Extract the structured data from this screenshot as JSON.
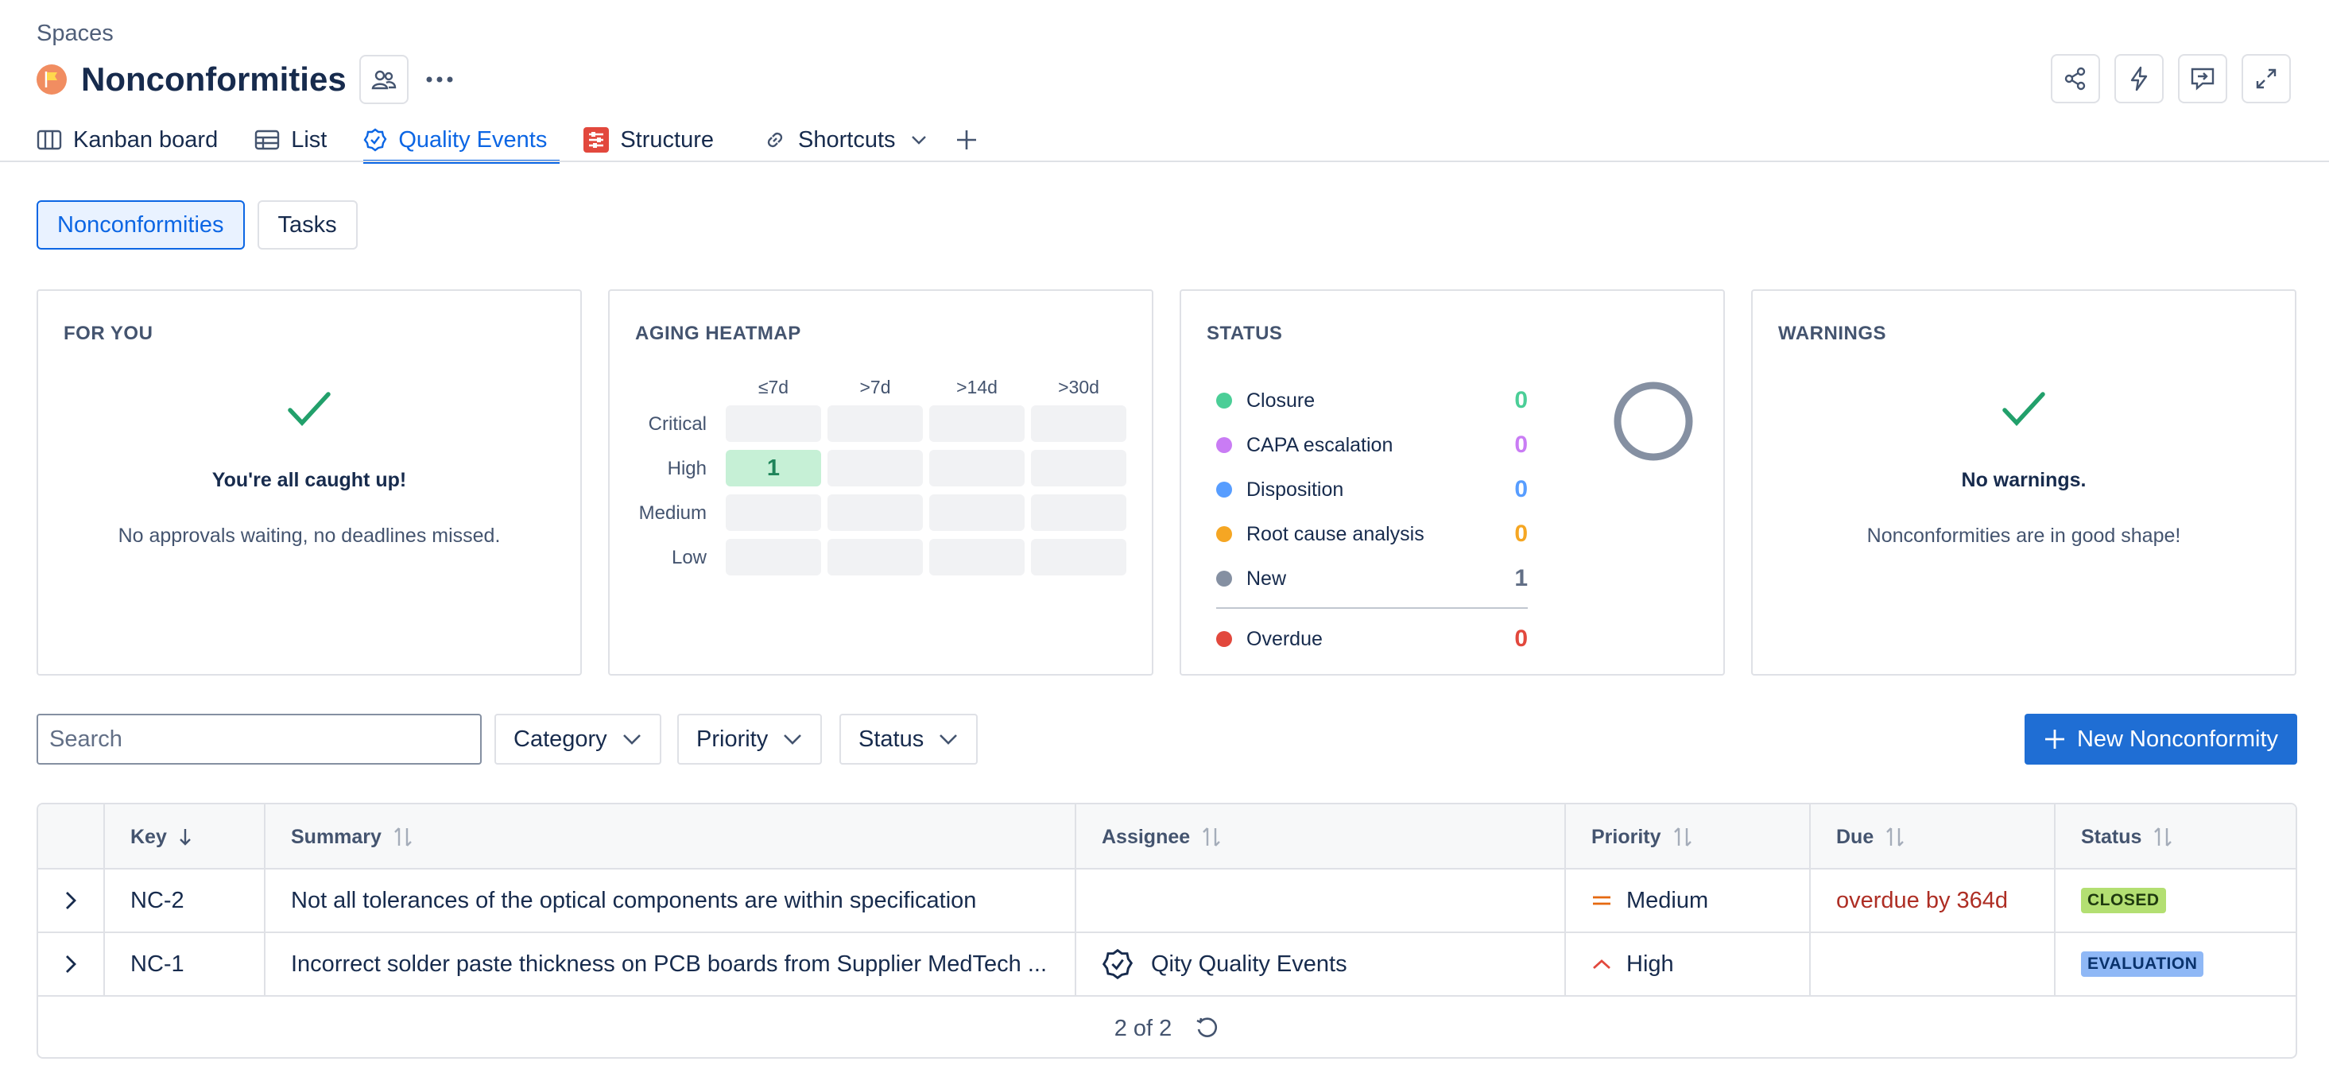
{
  "breadcrumb": "Spaces",
  "page_title": "Nonconformities",
  "tabs": [
    {
      "label": "Kanban board"
    },
    {
      "label": "List"
    },
    {
      "label": "Quality Events"
    },
    {
      "label": "Structure"
    },
    {
      "label": "Shortcuts"
    }
  ],
  "segments": [
    "Nonconformities",
    "Tasks"
  ],
  "for_you": {
    "title": "FOR YOU",
    "heading": "You're all caught up!",
    "message": "No approvals waiting, no deadlines missed."
  },
  "heatmap": {
    "title": "AGING HEATMAP",
    "columns": [
      "≤7d",
      ">7d",
      ">14d",
      ">30d"
    ],
    "rows": [
      "Critical",
      "High",
      "Medium",
      "Low"
    ],
    "values": [
      [
        "",
        "",
        "",
        ""
      ],
      [
        "1",
        "",
        "",
        ""
      ],
      [
        "",
        "",
        "",
        ""
      ],
      [
        "",
        "",
        "",
        ""
      ]
    ]
  },
  "status": {
    "title": "STATUS",
    "items": [
      {
        "name": "Closure",
        "count": "0",
        "color": "#4bce97"
      },
      {
        "name": "CAPA escalation",
        "count": "0",
        "color": "#c97cf4"
      },
      {
        "name": "Disposition",
        "count": "0",
        "color": "#579dff"
      },
      {
        "name": "Root cause analysis",
        "count": "0",
        "color": "#f5a623"
      },
      {
        "name": "New",
        "count": "1",
        "color": "#8590a2"
      }
    ],
    "overdue": {
      "name": "Overdue",
      "count": "0",
      "color": "#e2483d"
    }
  },
  "warnings": {
    "title": "WARNINGS",
    "heading": "No warnings.",
    "message": "Nonconformities are in good shape!"
  },
  "search_placeholder": "Search",
  "filters": [
    "Category",
    "Priority",
    "Status"
  ],
  "new_button": "New Nonconformity",
  "table": {
    "columns": [
      "Key",
      "Summary",
      "Assignee",
      "Priority",
      "Due",
      "Status"
    ],
    "rows": [
      {
        "key": "NC-2",
        "summary": "Not all tolerances of the optical components are within specification",
        "assignee": "",
        "priority": "Medium",
        "due": "overdue by 364d",
        "status": "CLOSED"
      },
      {
        "key": "NC-1",
        "summary": "Incorrect solder paste thickness on PCB boards from Supplier MedTech ...",
        "assignee": "Qity Quality Events",
        "priority": "High",
        "due": "",
        "status": "EVALUATION"
      }
    ],
    "pagination": "2 of 2"
  }
}
